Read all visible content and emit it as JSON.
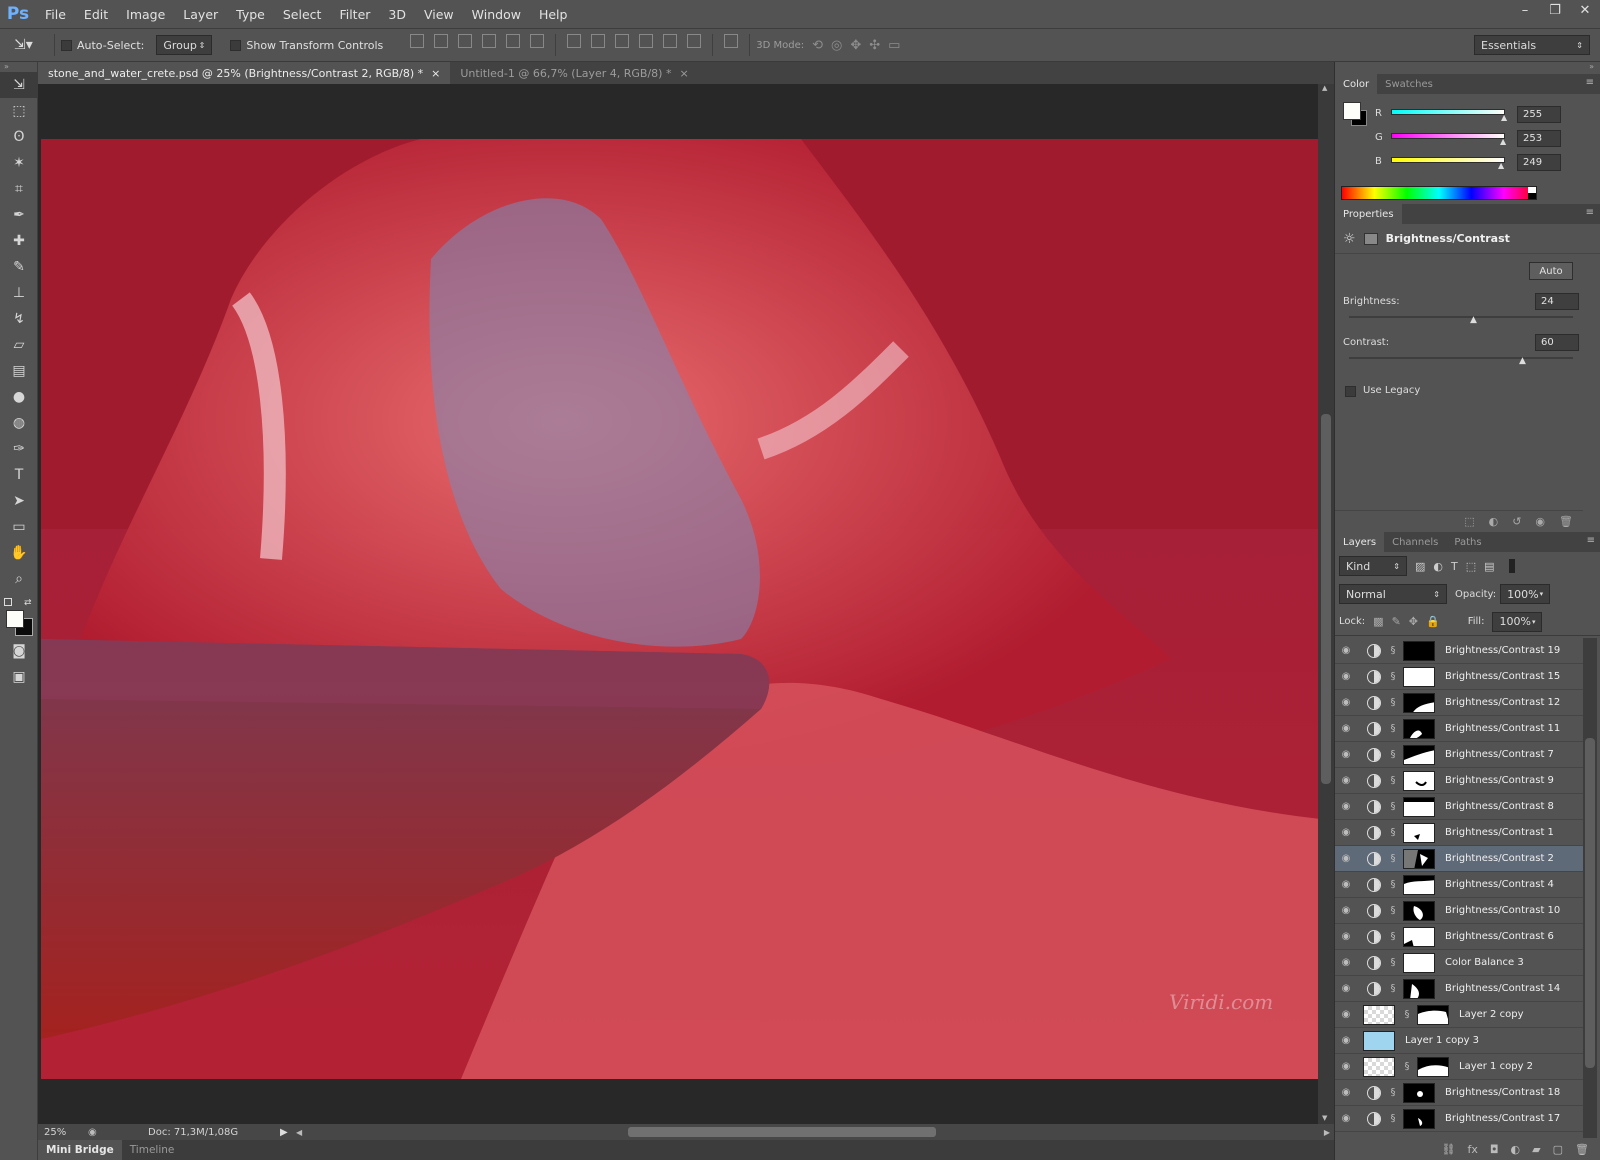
{
  "app": {
    "logo": "Ps"
  },
  "menu": [
    "File",
    "Edit",
    "Image",
    "Layer",
    "Type",
    "Select",
    "Filter",
    "3D",
    "View",
    "Window",
    "Help"
  ],
  "window_controls": [
    "minimize",
    "restore",
    "close"
  ],
  "options_bar": {
    "auto_select_label": "Auto-Select:",
    "auto_select_value": "Group",
    "show_transform_label": "Show Transform Controls",
    "mode_3d_label": "3D Mode:",
    "workspace": "Essentials"
  },
  "tools": [
    "move-tool",
    "marquee-tool",
    "lasso-tool",
    "magic-wand-tool",
    "crop-tool",
    "eyedropper-tool",
    "healing-brush-tool",
    "brush-tool",
    "clone-stamp-tool",
    "history-brush-tool",
    "eraser-tool",
    "gradient-tool",
    "blur-tool",
    "dodge-tool",
    "pen-tool",
    "type-tool",
    "path-selection-tool",
    "rectangle-tool",
    "hand-tool",
    "zoom-tool"
  ],
  "doc_tabs": [
    {
      "label": "stone_and_water_crete.psd @ 25% (Brightness/Contrast 2, RGB/8) *",
      "active": true
    },
    {
      "label": "Untitled-1 @ 66,7% (Layer 4, RGB/8) *",
      "active": false
    }
  ],
  "canvas": {
    "watermark": "Viridi.com"
  },
  "status": {
    "zoom": "25%",
    "doc": "Doc: 71,3M/1,08G"
  },
  "bottom_tabs": [
    {
      "label": "Mini Bridge",
      "active": true
    },
    {
      "label": "Timeline",
      "active": false
    }
  ],
  "color_panel": {
    "tabs": [
      {
        "label": "Color",
        "active": true
      },
      {
        "label": "Swatches",
        "active": false
      }
    ],
    "channels": [
      {
        "label": "R",
        "value": "255",
        "level": 1.0,
        "gradient": "linear-gradient(90deg,#00fdf9,#fffdf9)"
      },
      {
        "label": "G",
        "value": "253",
        "level": 0.99,
        "gradient": "linear-gradient(90deg,#ff00f9,#fffff9)"
      },
      {
        "label": "B",
        "value": "249",
        "level": 0.976,
        "gradient": "linear-gradient(90deg,#fffd00,#fffdff)"
      }
    ]
  },
  "properties_panel": {
    "tab": "Properties",
    "title": "Brightness/Contrast",
    "auto_label": "Auto",
    "brightness_label": "Brightness:",
    "brightness_value": "24",
    "brightness_level": 0.562,
    "contrast_label": "Contrast:",
    "contrast_value": "60",
    "contrast_level": 0.78,
    "use_legacy_label": "Use Legacy"
  },
  "layers_panel": {
    "tabs": [
      {
        "label": "Layers",
        "active": true
      },
      {
        "label": "Channels",
        "active": false
      },
      {
        "label": "Paths",
        "active": false
      }
    ],
    "filter_kind": "Kind",
    "blend_mode": "Normal",
    "opacity_label": "Opacity:",
    "opacity_value": "100%",
    "lock_label": "Lock:",
    "fill_label": "Fill:",
    "fill_value": "100%",
    "layers": [
      {
        "name": "Brightness/Contrast 19",
        "type": "adj",
        "mask": "black"
      },
      {
        "name": "Brightness/Contrast 15",
        "type": "adj",
        "mask": "white"
      },
      {
        "name": "Brightness/Contrast 12",
        "type": "adj",
        "mask": "shape1"
      },
      {
        "name": "Brightness/Contrast 11",
        "type": "adj",
        "mask": "shape2"
      },
      {
        "name": "Brightness/Contrast 7",
        "type": "adj",
        "mask": "shape3"
      },
      {
        "name": "Brightness/Contrast 9",
        "type": "adj",
        "mask": "shape4"
      },
      {
        "name": "Brightness/Contrast 8",
        "type": "adj",
        "mask": "shape5"
      },
      {
        "name": "Brightness/Contrast 1",
        "type": "adj",
        "mask": "shape6"
      },
      {
        "name": "Brightness/Contrast 2",
        "type": "adj",
        "mask": "shape7",
        "selected": true
      },
      {
        "name": "Brightness/Contrast 4",
        "type": "adj",
        "mask": "shape8"
      },
      {
        "name": "Brightness/Contrast 10",
        "type": "adj",
        "mask": "shape9"
      },
      {
        "name": "Brightness/Contrast 6",
        "type": "adj",
        "mask": "shape10"
      },
      {
        "name": "Color Balance 3",
        "type": "adj",
        "mask": "white"
      },
      {
        "name": "Brightness/Contrast 14",
        "type": "adj",
        "mask": "shape11"
      },
      {
        "name": "Layer 2 copy",
        "type": "pixel",
        "mask": "shape12"
      },
      {
        "name": "Layer 1 copy 3",
        "type": "pixel-nomask"
      },
      {
        "name": "Layer 1 copy 2",
        "type": "pixel",
        "mask": "shape13"
      },
      {
        "name": "Brightness/Contrast 18",
        "type": "adj",
        "mask": "shape14"
      },
      {
        "name": "Brightness/Contrast 17",
        "type": "adj",
        "mask": "shape15"
      }
    ]
  }
}
